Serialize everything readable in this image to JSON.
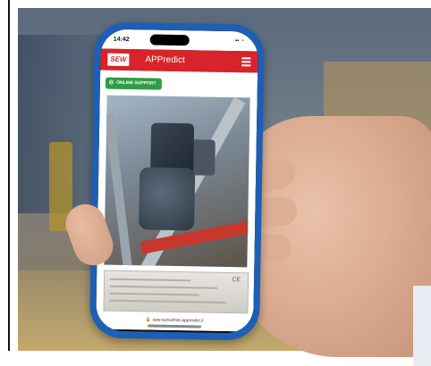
{
  "phone": {
    "status_time": "14:42",
    "status_icons": "▪▪ ◔",
    "brand": "SEW",
    "app_title": "APPredict",
    "support_label": "ONLINE SUPPORT",
    "nameplate_mark": "CE",
    "url": "sew-eurodrive.appredict.it"
  },
  "colors": {
    "app_bar": "#d8232a",
    "support_button": "#2e9e46",
    "phone_case": "#1d5fb4"
  }
}
